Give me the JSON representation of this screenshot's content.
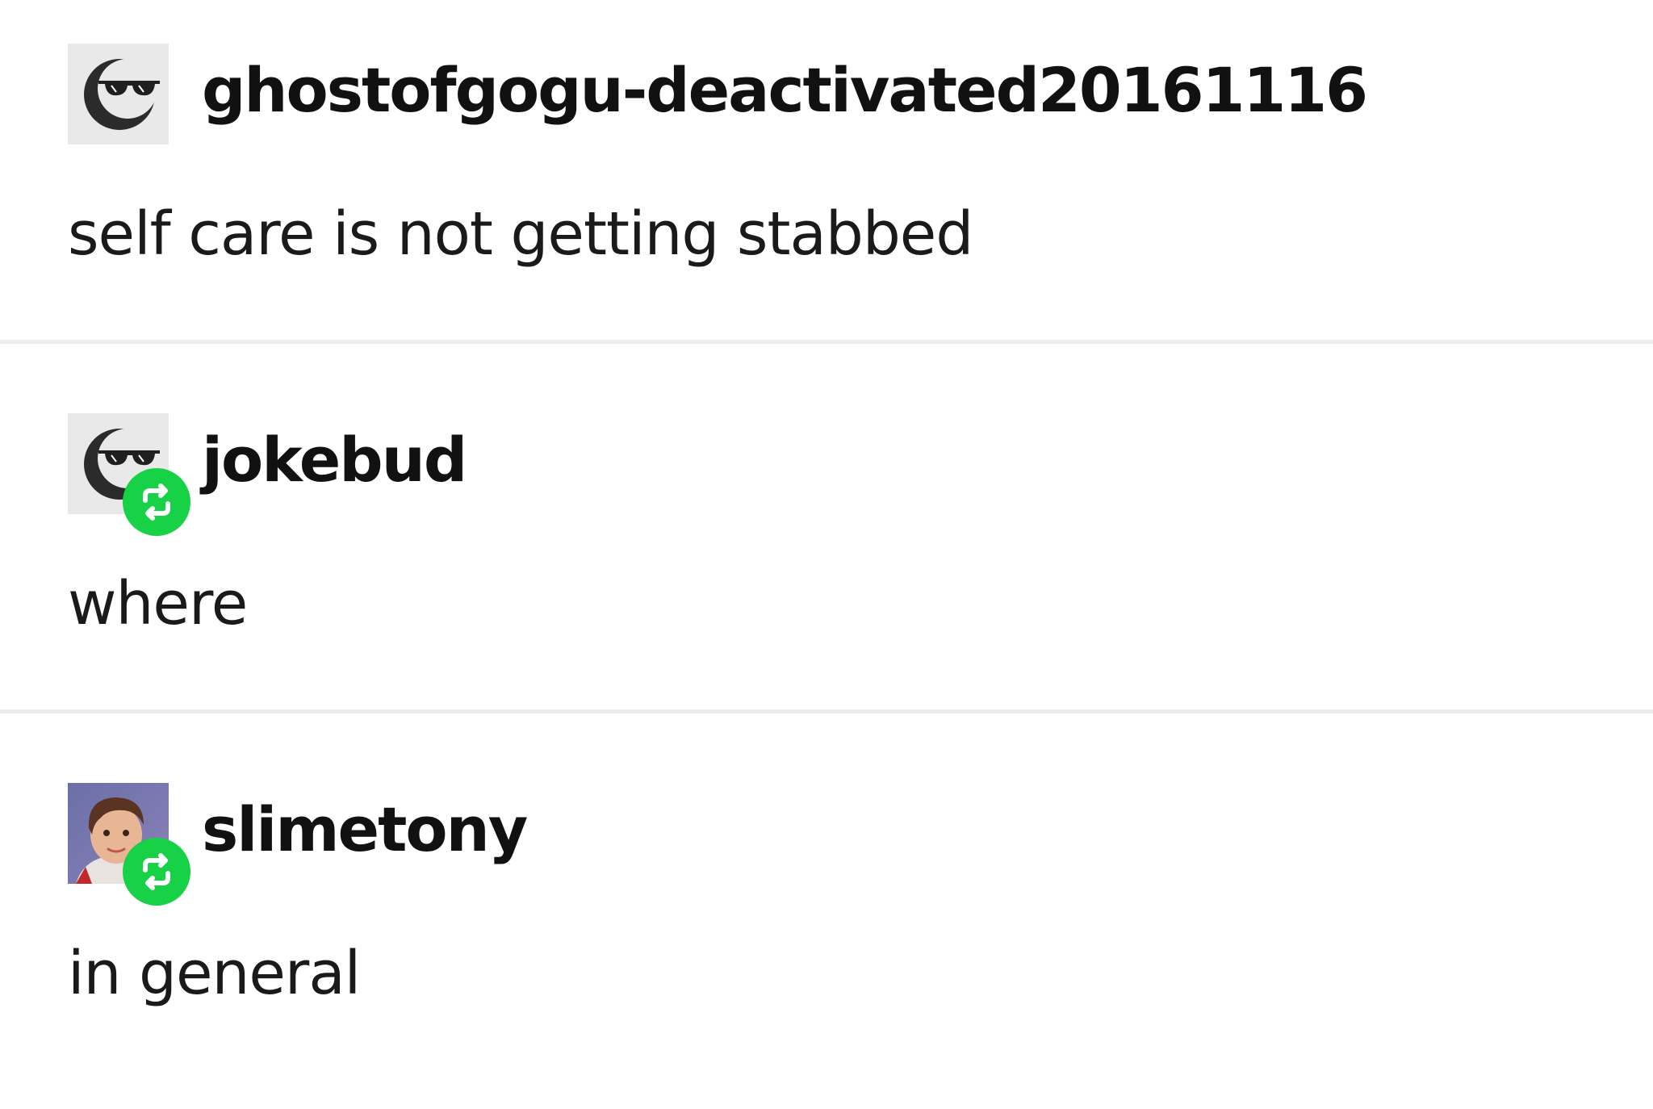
{
  "posts": [
    {
      "username": "ghostofgogu-deactivated20161116",
      "text": "self care is not getting stabbed",
      "avatar_icon": "sunglasses-moon-icon",
      "reblog": false
    },
    {
      "username": "jokebud",
      "text": "where",
      "avatar_icon": "sunglasses-moon-icon",
      "reblog": true
    },
    {
      "username": "slimetony",
      "text": "in general",
      "avatar_icon": "child-portrait-photo",
      "reblog": true
    }
  ],
  "colors": {
    "reblog_badge": "#17d146",
    "divider": "#ececec",
    "avatar_bg": "#e9e9e9"
  }
}
